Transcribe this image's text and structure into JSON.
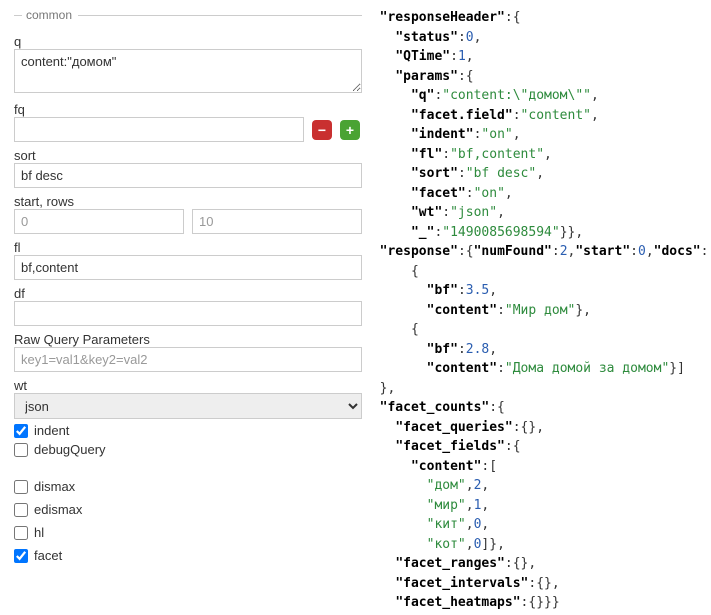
{
  "form": {
    "legend": "common",
    "q_label": "q",
    "q_value": "content:\"домом\"",
    "fq_label": "fq",
    "fq_value": "",
    "sort_label": "sort",
    "sort_value": "bf desc",
    "startrows_label": "start, rows",
    "start_placeholder": "0",
    "rows_placeholder": "10",
    "fl_label": "fl",
    "fl_value": "bf,content",
    "df_label": "df",
    "df_value": "",
    "raw_label": "Raw Query Parameters",
    "raw_placeholder": "key1=val1&key2=val2",
    "wt_label": "wt",
    "wt_value": "json",
    "indent_label": "indent",
    "indent_checked": true,
    "debugQuery_label": "debugQuery",
    "debugQuery_checked": false,
    "dismax_label": "dismax",
    "dismax_checked": false,
    "edismax_label": "edismax",
    "edismax_checked": false,
    "hl_label": "hl",
    "hl_checked": false,
    "facet_label": "facet",
    "facet_checked": true
  },
  "chart_data": {
    "type": "table",
    "title": "Solr JSON response",
    "responseHeader": {
      "status": 0,
      "QTime": 1,
      "params": {
        "q": "content:\"домом\"",
        "facet.field": "content",
        "indent": "on",
        "fl": "bf,content",
        "sort": "bf desc",
        "facet": "on",
        "wt": "json",
        "_": "1490085698594"
      }
    },
    "response": {
      "numFound": 2,
      "start": 0,
      "docs": [
        {
          "bf": 3.5,
          "content": "Мир дом"
        },
        {
          "bf": 2.8,
          "content": "Дома домой за домом"
        }
      ]
    },
    "facet_counts": {
      "facet_queries": {},
      "facet_fields": {
        "content": [
          "дом",
          2,
          "мир",
          1,
          "кит",
          0,
          "кот",
          0
        ]
      },
      "facet_ranges": {},
      "facet_intervals": {},
      "facet_heatmaps": {}
    }
  }
}
